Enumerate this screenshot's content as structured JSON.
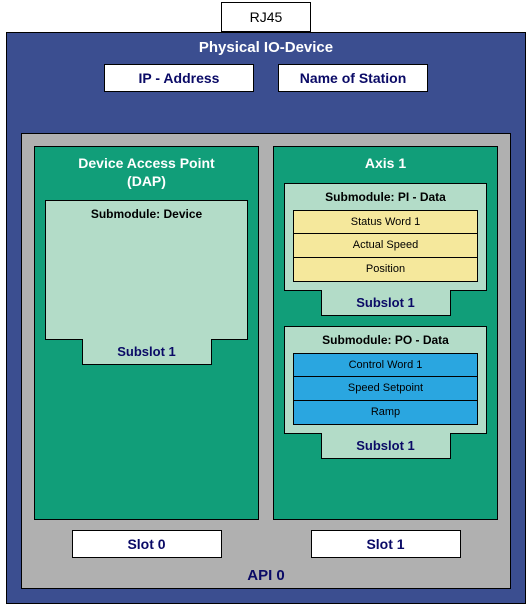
{
  "rj45": "RJ45",
  "physical_title": "Physical IO-Device",
  "top_boxes": {
    "ip": "IP - Address",
    "station": "Name of Station"
  },
  "api_label": "API 0",
  "dap": {
    "title_line1": "Device Access Point",
    "title_line2": "(DAP)",
    "submodule_title": "Submodule: Device",
    "subslot": "Subslot 1",
    "slot": "Slot 0"
  },
  "axis": {
    "title": "Axis 1",
    "pi": {
      "title": "Submodule: PI - Data",
      "rows": [
        "Status Word 1",
        "Actual Speed",
        "Position"
      ],
      "subslot": "Subslot 1"
    },
    "po": {
      "title": "Submodule: PO - Data",
      "rows": [
        "Control Word 1",
        "Speed Setpoint",
        "Ramp"
      ],
      "subslot": "Subslot 1"
    },
    "slot": "Slot 1"
  }
}
